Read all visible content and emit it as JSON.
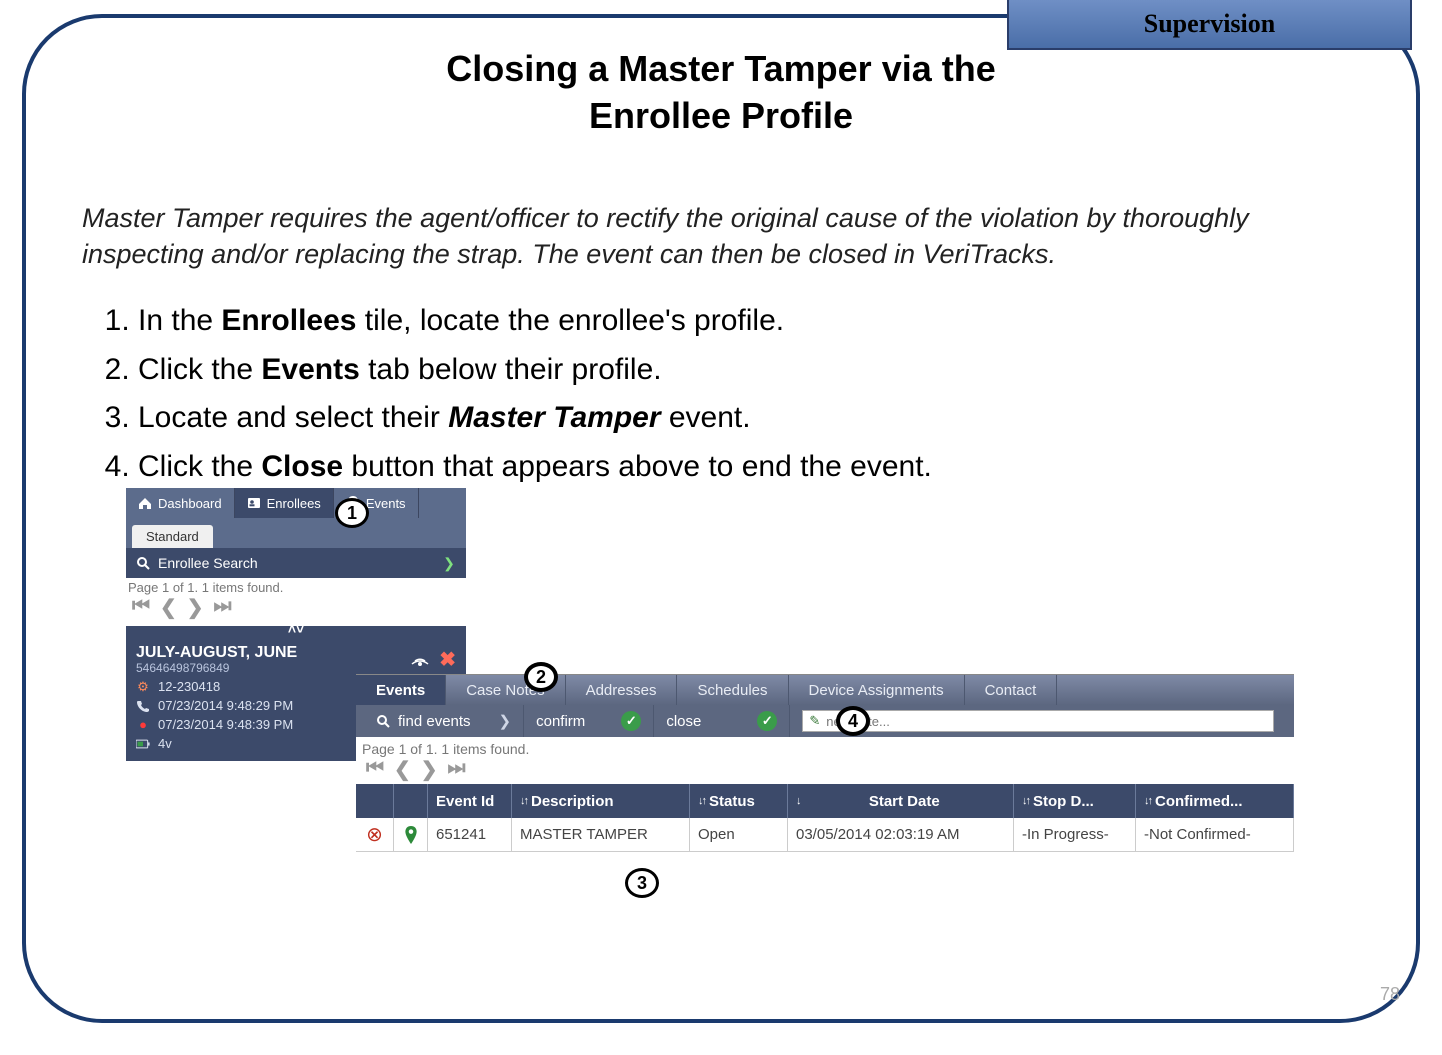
{
  "header_tab": "Supervision",
  "title_line1": "Closing a Master Tamper via the",
  "title_line2": "Enrollee Profile",
  "intro": "Master Tamper requires the agent/officer to rectify the original cause of the violation by thoroughly inspecting and/or replacing the strap. The event can then be closed in VeriTracks.",
  "steps": {
    "s1_a": "In the ",
    "s1_b": "Enrollees",
    "s1_c": " tile, locate the enrollee's profile.",
    "s2_a": "Click the ",
    "s2_b": "Events",
    "s2_c": " tab below their profile.",
    "s3_a": "Locate and select their ",
    "s3_b": "Master Tamper",
    "s3_c": " event.",
    "s4_a": "Click the ",
    "s4_b": "Close",
    "s4_c": " button that appears above to end the event."
  },
  "page_number": "78",
  "callouts": {
    "c1": "1",
    "c2": "2",
    "c3": "3",
    "c4": "4"
  },
  "app_tabs": {
    "dashboard": "Dashboard",
    "enrollees": "Enrollees",
    "events": "Events"
  },
  "subtab": "Standard",
  "search_label": "Enrollee Search",
  "sidebar_pager": "Page 1 of 1. 1 items found.",
  "enrollee": {
    "name": "JULY-AUGUST, JUNE",
    "id": "54646498796849",
    "case_row": "12-230418",
    "phone_row": "07/23/2014 9:48:29 PM",
    "dot_row": "07/23/2014 9:48:39 PM",
    "battery_row": "4v"
  },
  "detail_tabs": {
    "events": "Events",
    "case_notes": "Case Notes",
    "addresses": "Addresses",
    "schedules": "Schedules",
    "device_assignments": "Device Assignments",
    "contact": "Contact"
  },
  "toolbar": {
    "find_events": "find events",
    "confirm": "confirm",
    "close": "close",
    "new_note": "new note..."
  },
  "table_pager": "Page 1 of 1. 1 items found.",
  "table_headers": {
    "event_id": "Event Id",
    "description": "Description",
    "status": "Status",
    "start_date": "Start Date",
    "stop_date": "Stop D...",
    "confirmed": "Confirmed..."
  },
  "table_row": {
    "event_id": "651241",
    "description": "MASTER TAMPER",
    "status": "Open",
    "start_date": "03/05/2014 02:03:19 AM",
    "stop_date": "-In Progress-",
    "confirmed": "-Not Confirmed-"
  }
}
